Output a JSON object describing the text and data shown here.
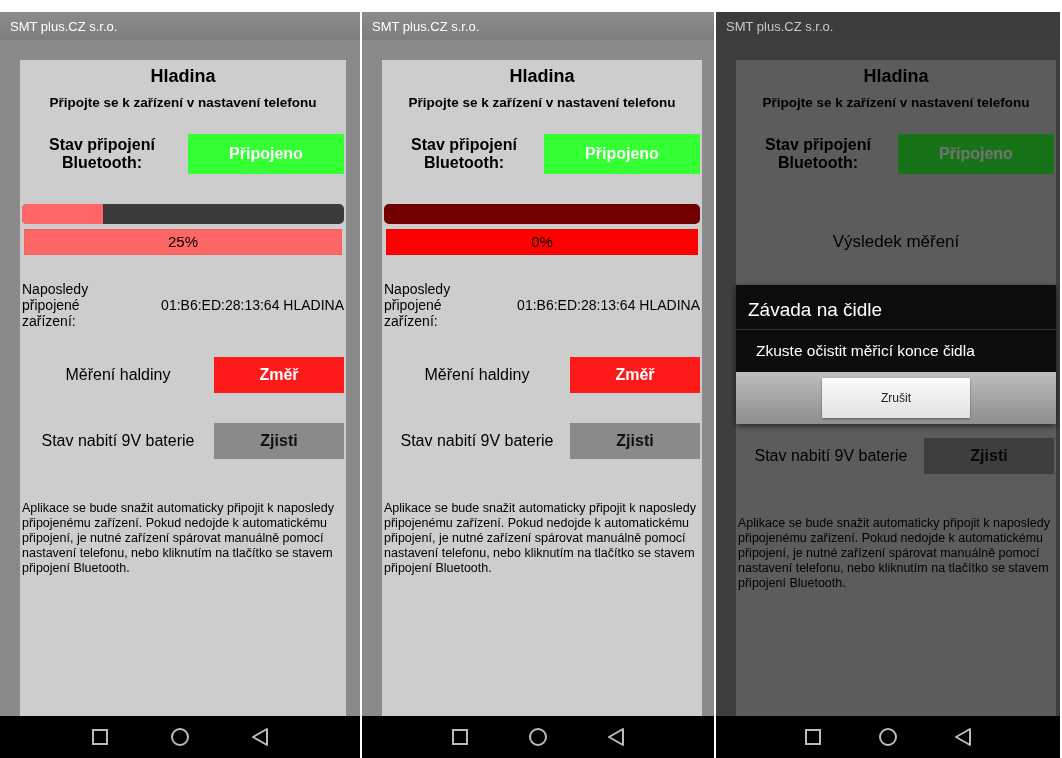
{
  "screens": [
    {
      "app_title": "SMT plus.CZ s.r.o.",
      "dimmed": false,
      "heading": "Hladina",
      "subheading": "Připojte se k zařízení v nastavení telefonu",
      "bt_label": "Stav připojení Bluetooth:",
      "bt_status": "Připojeno",
      "middle": {
        "kind": "gauge",
        "level": 0.25,
        "reading": "25%",
        "color": "#ff6666"
      },
      "last_device_label": "Naposledy připojené zařízení:",
      "last_device_value": "01:B6:ED:28:13:64 HLADINA",
      "measure_label": "Měření haldiny",
      "measure_button": "Změř",
      "battery_label": "Stav nabití 9V baterie",
      "battery_button": "Zjisti",
      "note": "Aplikace se bude snažit automaticky připojit k naposledy připojenému zařízení. Pokud nedojde k automatickému připojení, je nutné zařízení spárovat manuálně pomocí nastavení telefonu, nebo kliknutím na tlačítko se stavem připojení Bluetooth."
    },
    {
      "app_title": "SMT plus.CZ s.r.o.",
      "dimmed": false,
      "heading": "Hladina",
      "subheading": "Připojte se k zařízení v nastavení telefonu",
      "bt_label": "Stav připojení Bluetooth:",
      "bt_status": "Připojeno",
      "middle": {
        "kind": "gauge",
        "level": 0,
        "reading": "0%",
        "color": "#ff0000"
      },
      "last_device_label": "Naposledy připojené zařízení:",
      "last_device_value": "01:B6:ED:28:13:64 HLADINA",
      "measure_label": "Měření haldiny",
      "measure_button": "Změř",
      "battery_label": "Stav nabití 9V baterie",
      "battery_button": "Zjisti",
      "note": "Aplikace se bude snažit automaticky připojit k naposledy připojenému zařízení. Pokud nedojde k automatickému připojení, je nutné zařízení spárovat manuálně pomocí nastavení telefonu, nebo kliknutím na tlačítko se stavem připojení Bluetooth."
    },
    {
      "app_title": "SMT plus.CZ s.r.o.",
      "dimmed": true,
      "heading": "Hladina",
      "subheading": "Připojte se k zařízení v nastavení telefonu",
      "bt_label": "Stav připojení Bluetooth:",
      "bt_status": "Připojeno",
      "middle": {
        "kind": "result",
        "text": "Výsledek měření"
      },
      "battery_label": "Stav nabití 9V baterie",
      "battery_button": "Zjisti",
      "note": "Aplikace se bude snažit automaticky připojit k naposledy připojenému zařízení. Pokud nedojde k automatickému připojení, je nutné zařízení spárovat manuálně pomocí nastavení telefonu, nebo kliknutím na tlačítko se stavem připojení Bluetooth.",
      "dialog": {
        "title": "Závada na čidle",
        "message": "Zkuste očistit měřicí konce čidla",
        "button": "Zrušit"
      }
    }
  ]
}
